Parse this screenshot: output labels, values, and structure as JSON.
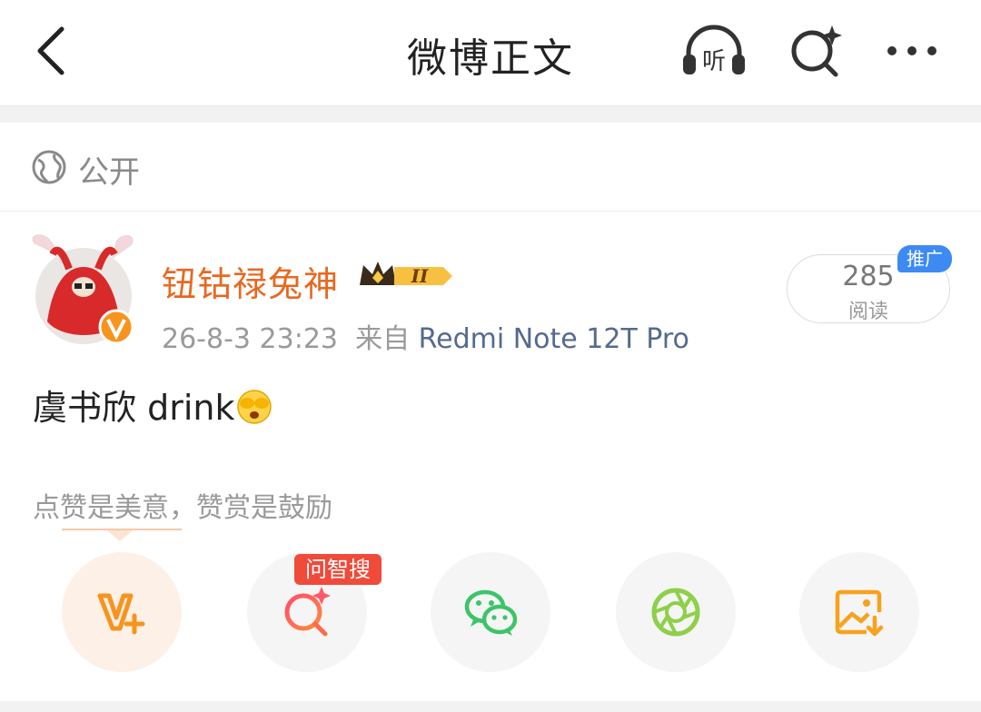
{
  "header": {
    "title": "微博正文",
    "icons": [
      "back-arrow-icon",
      "listen-headphones-icon",
      "ai-search-icon",
      "more-dots-icon"
    ],
    "listen_label": "听"
  },
  "visibility": {
    "icon": "globe-icon",
    "label": "公开"
  },
  "post": {
    "author": "钮钴禄兔神",
    "verified": true,
    "level_badge": "II",
    "time": "26-8-3 23:23",
    "source_prefix": "来自",
    "source_device": "Redmi Note 12T Pro",
    "reads_count": "285",
    "reads_label": "阅读",
    "promo_label": "推广",
    "text": "虞书欣  drink"
  },
  "reward_hint": "点赞是美意，赞赏是鼓励",
  "actions": [
    {
      "name": "reward",
      "icon": "reward-v-plus-icon"
    },
    {
      "name": "ai-search",
      "icon": "ai-search-icon",
      "badge": "问智搜"
    },
    {
      "name": "wechat",
      "icon": "wechat-icon"
    },
    {
      "name": "moments",
      "icon": "moments-shutter-icon"
    },
    {
      "name": "save-image",
      "icon": "save-image-icon"
    }
  ],
  "colors": {
    "accent": "#e8681f",
    "link": "#546a8f",
    "promo": "#3d8bf2",
    "badge": "#f04a3a",
    "wechat": "#3cc46a"
  }
}
